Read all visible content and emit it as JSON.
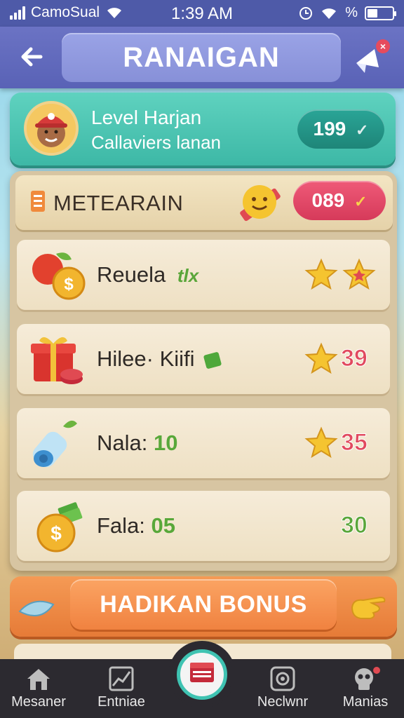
{
  "status_bar": {
    "carrier": "CamoSual",
    "time": "1:39 AM",
    "icons": [
      "signal-icon",
      "wifi-icon",
      "clock-icon",
      "wifi-icon",
      "percent-icon",
      "battery-icon"
    ]
  },
  "header": {
    "title": "RANAIGAN",
    "back_icon": "back-arrow-icon",
    "share_icon": "share-icon"
  },
  "level_card": {
    "title": "Level Harjan",
    "subtitle": "Callaviers lanan",
    "badge_value": "199"
  },
  "section": {
    "title": "METEARAIN",
    "badge_value": "089"
  },
  "rows": [
    {
      "label": "Reuela",
      "tag": "tlx",
      "icon": "apple-coin-icon",
      "stars": 2
    },
    {
      "label": "Hilee· Kiifi",
      "icon": "gift-box-icon",
      "value": "39"
    },
    {
      "label": "Nala:",
      "amount": "10",
      "icon": "water-bottle-icon",
      "value": "35"
    },
    {
      "label": "Fala:",
      "amount": "05",
      "icon": "coin-cash-icon",
      "value": "30"
    }
  ],
  "bonus": {
    "label": "HADIKAN BONUS"
  },
  "nav": {
    "items": [
      {
        "label": "Mesaner",
        "icon": "home-icon"
      },
      {
        "label": "Entniae",
        "icon": "chart-icon"
      },
      {
        "label": "",
        "icon": "book-icon"
      },
      {
        "label": "Neclwnr",
        "icon": "gear-badge-icon"
      },
      {
        "label": "Manias",
        "icon": "skull-icon"
      }
    ]
  },
  "colors": {
    "header": "#5962b6",
    "level_card": "#3db8a6",
    "section_badge": "#d63a5a",
    "bonus": "#e67b37",
    "nav": "#2c2a30",
    "star": "#f5c430"
  }
}
